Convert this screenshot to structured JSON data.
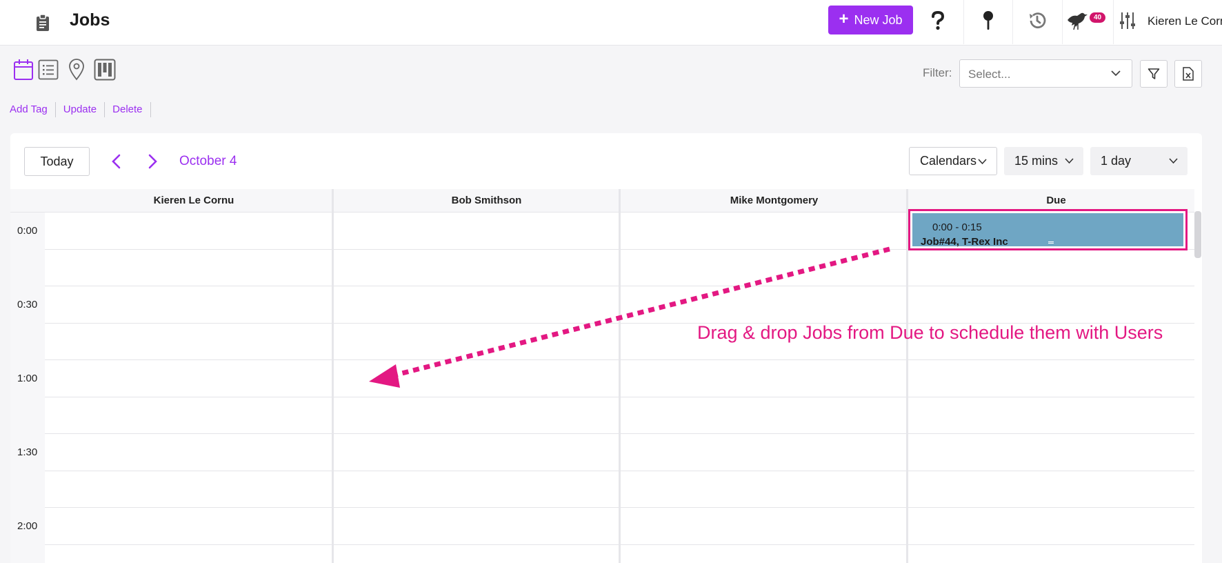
{
  "header": {
    "title": "Jobs",
    "new_job_label": "New Job",
    "notification_count": "40",
    "user_name": "Kieren Le Cornu"
  },
  "toolbar": {
    "filter_label": "Filter:",
    "filter_placeholder": "Select..."
  },
  "actions": [
    "Add Tag",
    "Update",
    "Delete"
  ],
  "calendar": {
    "today_label": "Today",
    "date_label": "October 4",
    "calendars_label": "Calendars",
    "interval_label": "15 mins",
    "range_label": "1 day",
    "columns": [
      "Kieren Le Cornu",
      "Bob Smithson",
      "Mike Montgomery",
      "Due"
    ],
    "time_labels": [
      "0:00",
      "0:30",
      "1:00",
      "1:30",
      "2:00"
    ]
  },
  "event": {
    "time": "0:00 - 0:15",
    "title": "Job#44, T-Rex Inc",
    "color": "#6fa6c4"
  },
  "annotation": "Drag & drop Jobs from Due to schedule them with Users",
  "colors": {
    "accent": "#9b2ff0",
    "annotation": "#e31882",
    "badge": "#d1156b"
  }
}
